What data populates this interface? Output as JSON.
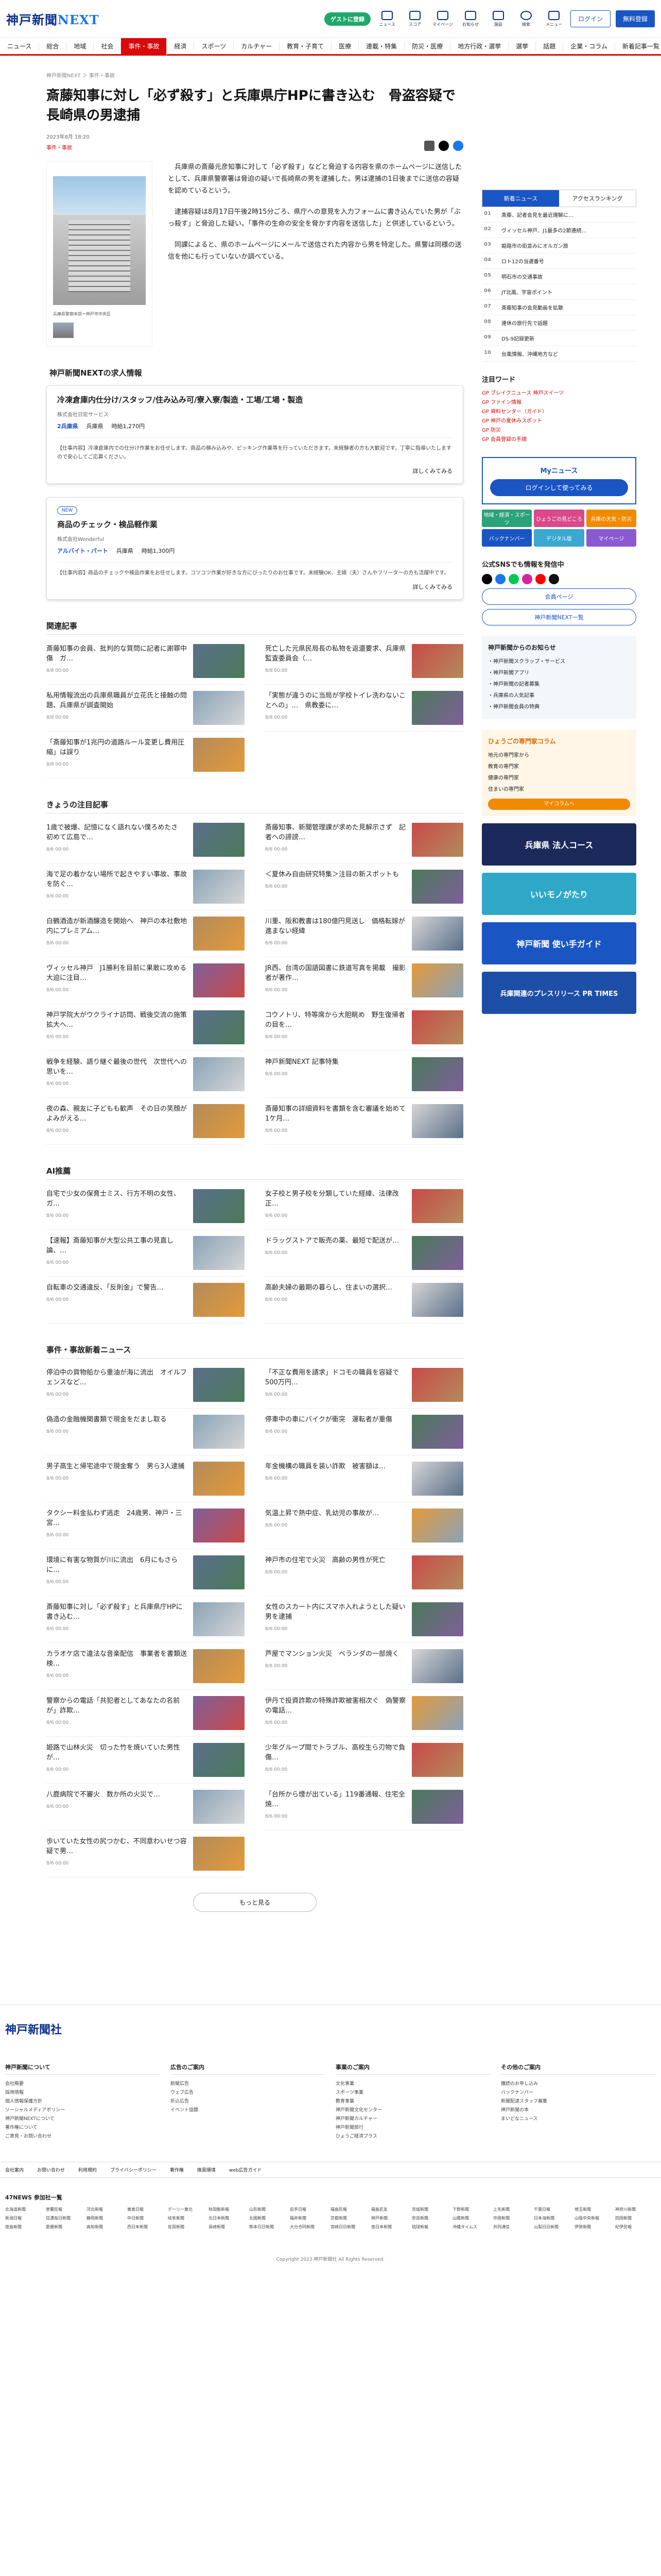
{
  "header": {
    "logo_a": "神戸新聞",
    "logo_b": "NEXT",
    "pill": "ゲストに登録",
    "icons": [
      "ニュース",
      "スコア",
      "マイページ",
      "お知らせ",
      "施設"
    ],
    "search": "検索",
    "search2": "メニュー",
    "login": "ログイン",
    "register": "無料登録"
  },
  "nav": [
    "ニュース",
    "総合",
    "地域",
    "社会",
    "事件・事故",
    "経済",
    "スポーツ",
    "カルチャー",
    "教育・子育て",
    "医療",
    "連載・特集",
    "防災・医療",
    "地方行政・選挙",
    "選挙",
    "話題",
    "企業・コラム",
    "新着記事一覧"
  ],
  "article": {
    "crumb": "神戸新聞NEXT ＞ 事件・事故",
    "title": "斎藤知事に対し「必ず殺す」と兵庫県庁HPに書き込む　骨盗容疑で長崎県の男逮捕",
    "date": "2023年8月 18:20",
    "category": "事件・事故",
    "caption": "兵庫県警察本部＝神戸市中央区",
    "paras": [
      "兵庫県の斎藤元彦知事に対して「必ず殺す」などと脅迫する内容を県のホームページに送信したとして、兵庫県警察署は脅迫の疑いで長崎県の男を逮捕した。男は逮捕の1日後までに送信の容疑を認めているという。",
      "逮捕容疑は8月17日午後2時15分ごろ、県庁への意見を入力フォームに書き込んでいた男が「ぶっ殺す」と脅迫した疑い。「事件の生命の安全を脅かす内容を送信した」と供述しているという。",
      "同課によると、県のホームページにメールで送信された内容から男を特定した。県警は同様の送信を他にも行っていないか調べている。"
    ]
  },
  "jobs": {
    "heading": "神戸新聞NEXTの求人情報",
    "items": [
      {
        "new": "",
        "title": "冷凍倉庫内仕分け/スタッフ/住み込み可/寮入寮/製造・工場/工場・製造",
        "company": "株式会社日宏サービス",
        "area": "2兵庫県",
        "sub": "兵庫県",
        "pay": "時給1,270円",
        "desc": "【仕事内容】冷凍倉庫内での仕分け作業をお任せします。商品の積み込みや、ピッキング作業等を行っていただきます。未経験者の方も大歓迎です。丁寧に指導いたしますので安心してご応募ください。",
        "more": "詳しくみてみる"
      },
      {
        "new": "NEW",
        "title": "商品のチェック・検品軽作業",
        "company": "株式会社Wonderful",
        "area": "アルバイト・パート",
        "sub": "兵庫県",
        "pay": "時給1,300円",
        "desc": "【仕事内容】商品のチェックや検品作業をお任せします。コツコツ作業が好きな方にぴったりのお仕事です。未経験OK、主婦（夫）さんやフリーターの方も活躍中です。",
        "more": "詳しくみてみる"
      }
    ]
  },
  "related": {
    "heading": "関連記事",
    "items": [
      {
        "t": "斎藤知事の会員、批判的な質問に記者に謝罪中傷　ガ…",
        "d": "8/8 00:00"
      },
      {
        "t": "死亡した元県民局長の私物を返還要求、兵庫県監査委員会（…",
        "d": "8/8 00:00"
      },
      {
        "t": "私用情報流出の兵庫県職員が立花氏と接触の問題、兵庫県が調査開始",
        "d": "8/8 00:00"
      },
      {
        "t": "「実態が違うのに当局が学校トイレ洗わないことへの」…　県教委に…",
        "d": "8/8 00:00"
      },
      {
        "t": "「斎藤知事が1兆円の道路ルール変更し費用圧縮」は誤り",
        "d": "8/8 00:00"
      }
    ]
  },
  "attention": {
    "heading": "きょうの注目記事",
    "items": [
      {
        "t": "1歳で被爆、記憶になく語れない僕ろめたさ　初めて広島で…",
        "d": "8/6 00:00"
      },
      {
        "t": "斎藤知事、新聞管理課が求めた見解示さず　記者への誹謗…",
        "d": "8/6 00:00"
      },
      {
        "t": "海で足の着かない場所で起きやすい事故、事故を防ぐ…",
        "d": "8/6 00:00"
      },
      {
        "t": "＜夏休み自由研究特集＞注目の新スポットも",
        "d": "8/6 00:00"
      },
      {
        "t": "白鶴酒造が新酒醸造を開始へ　神戸の本社敷地内にプレミアム…",
        "d": "8/6 00:00"
      },
      {
        "t": "川重、阪和教書は180億円見送し　価格転嫁が進まない経緯",
        "d": "8/6 00:00"
      },
      {
        "t": "ヴィッセル神戸　J1勝利を目前に果敢に攻める大迫に注目…",
        "d": "8/6 00:00"
      },
      {
        "t": "JR西、台湾の国語図書に鉄道写真を掲載　撮影者が著作…",
        "d": "8/6 00:00"
      },
      {
        "t": "神戸学院大がウクライナ訪問、戦後交流の施策拡大へ…",
        "d": "8/6 00:00"
      },
      {
        "t": "コウノトリ、特等席から大胆眺め　野生復帰者の目を…",
        "d": "8/6 00:00"
      },
      {
        "t": "戦争を経験、語り継ぐ最後の世代　次世代への思いを…",
        "d": "8/6 00:00"
      },
      {
        "t": "神戸新聞NEXT 記事特集",
        "d": "8/6 00:00"
      },
      {
        "t": "夜の森、親友に子どもも歓声　その日の笑顔がよみがえる…",
        "d": "8/6 00:00"
      },
      {
        "t": "斎藤知事の詳細資料を書類を含む審議を始めて1ケ月…",
        "d": "8/6 00:00"
      }
    ]
  },
  "ai": {
    "heading": "AI推薦",
    "items": [
      {
        "t": "自宅で少女の保育士ミス、行方不明の女性、ガ…",
        "d": "8/6 00:00"
      },
      {
        "t": "女子校と男子校を分類していた経緯、法律改正…",
        "d": "8/6 00:00"
      },
      {
        "t": "【速報】斎藤知事が大型公共工事の見直し論、…",
        "d": "8/6 00:00"
      },
      {
        "t": "ドラッグストアで販売の薬、最短で配送が…",
        "d": "8/6 00:00"
      },
      {
        "t": "自転車の交通違反、「反則金」で警告…",
        "d": "8/6 00:00"
      },
      {
        "t": "高齢夫婦の最期の暮らし、住まいの選択…",
        "d": "8/6 00:00"
      }
    ]
  },
  "incidents": {
    "heading": "事件・事故新着ニュース",
    "items": [
      {
        "t": "停泊中の貨物船から重油が海に流出　オイルフェンスなど…",
        "d": "8/6 00:00"
      },
      {
        "t": "「不正な費用を請求」ドコモの職員を容疑で500万円…",
        "d": "8/6 00:00"
      },
      {
        "t": "偽造の金融機関書類で現金をだまし取る",
        "d": "8/6 00:00"
      },
      {
        "t": "停車中の車にバイクが衝突　運転者が重傷",
        "d": "8/6 00:00"
      },
      {
        "t": "男子高生と帰宅途中で現金奪う　男ら3人逮捕",
        "d": "8/6 00:00"
      },
      {
        "t": "年金機構の職員を装い詐欺　被害額は…",
        "d": "8/6 00:00"
      },
      {
        "t": "タクシー料金払わず逃走　24歳男、神戸・三宮…",
        "d": "8/6 00:00"
      },
      {
        "t": "気温上昇で熱中症、乳幼児の事故が…",
        "d": "8/6 00:00"
      },
      {
        "t": "環境に有害な物質が川に流出　6月にもさらに…",
        "d": "8/6 00:00"
      },
      {
        "t": "神戸市の住宅で火災　高齢の男性が死亡",
        "d": "8/6 00:00"
      },
      {
        "t": "斎藤知事に対し「必ず殺す」と兵庫県庁HPに書き込む…",
        "d": "8/6 00:00"
      },
      {
        "t": "女性のスカート内にスマホ入れようとした疑い　男を逮捕",
        "d": "8/6 00:00"
      },
      {
        "t": "カラオケ店で違法な音楽配信　事業者を書類送検…",
        "d": "8/6 00:00"
      },
      {
        "t": "芦屋でマンション火災　ベランダの一部焼く",
        "d": "8/6 00:00"
      },
      {
        "t": "警察からの電話「共犯者としてあなたの名前が」詐欺…",
        "d": "8/6 00:00"
      },
      {
        "t": "伊丹で投資詐欺の特殊詐欺被害相次ぐ　偽警察の電話…",
        "d": "8/6 00:00"
      },
      {
        "t": "姫路で山林火災　切った竹を焼いていた男性が…",
        "d": "8/6 00:00"
      },
      {
        "t": "少年グループ間でトラブル、高校生ら刃物で負傷…",
        "d": "8/6 00:00"
      },
      {
        "t": "八鹿病院で不審火　数か所の火災で…",
        "d": "8/6 00:00"
      },
      {
        "t": "「台所から煙が出ている」119番通報、住宅全焼…",
        "d": "8/6 00:00"
      },
      {
        "t": "歩いていた女性の尻つかむ、不同意わいせつ容疑で男…",
        "d": "8/6 00:00"
      }
    ],
    "more": "もっと見る"
  },
  "sidebar": {
    "tabs": [
      "新着ニュース",
      "アクセスランキング"
    ],
    "rank": [
      {
        "n": "01",
        "t": "斎藤、記者会見を最近理解に…"
      },
      {
        "n": "02",
        "t": "ヴィッセル神戸、J1最多の2節連続…"
      },
      {
        "n": "03",
        "t": "姫路市の街並みにオルガン旅"
      },
      {
        "n": "04",
        "t": "ロト12の当選番号"
      },
      {
        "n": "05",
        "t": "明石市の交通事故"
      },
      {
        "n": "06",
        "t": "JT北風、宇宙ポイント"
      },
      {
        "n": "07",
        "t": "斎藤知事の会見動画を拡散"
      },
      {
        "n": "08",
        "t": "連休の旅行先で話題"
      },
      {
        "n": "09",
        "t": "DS-9記録更新"
      },
      {
        "n": "10",
        "t": "台風情報、沖縄地方など"
      }
    ],
    "kw_heading": "注目ワード",
    "keywords": [
      "GP ブレイクニュース 神戸スイーツ",
      "GP ファイン情報",
      "GP 資料センター（ガイド）",
      "GP 神戸の夏休みスポット",
      "GP 防災",
      "GP 会員登録の手順"
    ],
    "login_title": "Myニュース",
    "login_btn": "ログインして使ってみる",
    "tiles": [
      "地域・経済・スポーツ",
      "ひょうごの見どころ",
      "兵庫の天気・防災",
      "バックナンバー",
      "デジタル版",
      "マイページ"
    ],
    "sns_heading": "公式SNSでも情報を発信中",
    "btn1": "会員ページ",
    "btn2": "神戸新聞NEXT一覧",
    "info_heading": "神戸新聞からのお知らせ",
    "info": [
      "・神戸新聞スクラップ・サービス",
      "・神戸新聞アプリ",
      "・神戸新聞の記者募集",
      "・兵庫県の人気記事",
      "・神戸新聞会員の特典"
    ],
    "column_title": "ひょうごの専門家コラム",
    "column_items": [
      "地元の専門家から",
      "教育の専門家",
      "健康の専門家",
      "住まいの専門家"
    ],
    "column_btn": "マイコラムへ",
    "banners": [
      "兵庫県 法人コース",
      "いいモノがたり",
      "神戸新聞 使い手ガイド",
      "兵庫関連のプレスリリース PR TIMES"
    ]
  },
  "footer": {
    "logo": "神戸新聞社",
    "cols": [
      {
        "h": "神戸新聞について",
        "items": [
          "会社概要",
          "採用情報",
          "個人情報保護方針",
          "ソーシャルメディアポリシー",
          "神戸新聞NEXTについて",
          "著作権について",
          "ご意見・お問い合わせ"
        ]
      },
      {
        "h": "広告のご案内",
        "items": [
          "新聞広告",
          "ウェブ広告",
          "折込広告",
          "イベント協賛"
        ]
      },
      {
        "h": "事業のご案内",
        "items": [
          "文化事業",
          "スポーツ事業",
          "教育事業",
          "神戸新聞文化センター",
          "神戸新聞カルチャー",
          "神戸新聞旅行",
          "ひょうご経済プラス"
        ]
      },
      {
        "h": "その他のご案内",
        "items": [
          "購読のお申し込み",
          "バックナンバー",
          "新聞配達スタッフ募集",
          "神戸新聞の本",
          "まいどなニュース"
        ]
      }
    ],
    "bar": [
      "会社案内",
      "お問い合わせ",
      "利用規約",
      "プライバシーポリシー",
      "著作権",
      "推奨環境",
      "web広告ガイド"
    ],
    "n47": "47NEWS 参加社一覧",
    "n47_list": [
      "北海道新聞",
      "室蘭民報",
      "河北新報",
      "東奥日報",
      "デーリー東北",
      "秋田魁新報",
      "山形新聞",
      "岩手日報",
      "福島民報",
      "福島民友",
      "茨城新聞",
      "下野新聞",
      "上毛新聞",
      "千葉日報",
      "埼玉新聞",
      "神奈川新聞",
      "新潟日報",
      "信濃毎日新聞",
      "静岡新聞",
      "中日新聞",
      "岐阜新聞",
      "北日本新聞",
      "北國新聞",
      "福井新聞",
      "京都新聞",
      "神戸新聞",
      "奈良新聞",
      "山陽新聞",
      "中国新聞",
      "日本海新聞",
      "山陰中央新報",
      "四国新聞",
      "徳島新聞",
      "愛媛新聞",
      "高知新聞",
      "西日本新聞",
      "佐賀新聞",
      "長崎新聞",
      "熊本日日新聞",
      "大分合同新聞",
      "宮崎日日新聞",
      "南日本新聞",
      "琉球新報",
      "沖縄タイムス",
      "共同通信",
      "山梨日日新聞",
      "伊勢新聞",
      "紀伊民報"
    ],
    "copy": "Copyright 2023 神戸新聞社 All Rights Reserved."
  }
}
